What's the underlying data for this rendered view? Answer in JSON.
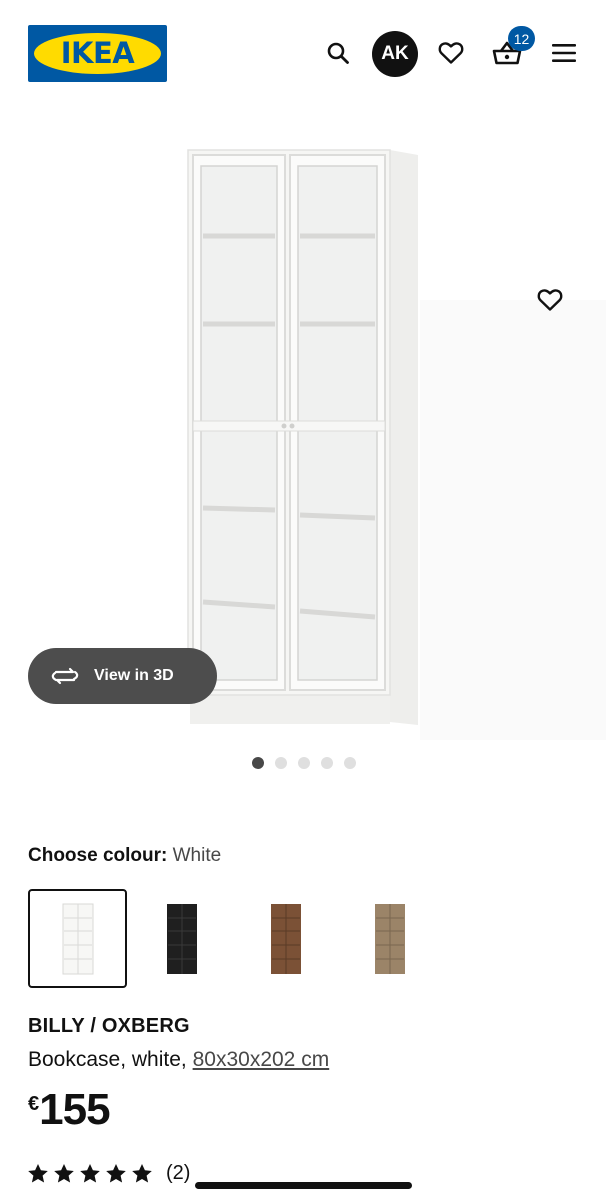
{
  "header": {
    "logo_text": "IKEA",
    "avatar_initials": "AK",
    "cart_count": "12",
    "icons": [
      "search-icon",
      "heart-icon",
      "basket-icon",
      "menu-icon"
    ],
    "brand_blue": "#0058a3",
    "brand_yellow": "#ffdb00"
  },
  "gallery": {
    "view_3d_label": "View in 3D",
    "image_count": 5,
    "active_index": 0
  },
  "colour": {
    "label": "Choose colour:",
    "selected_value": "White",
    "options": [
      {
        "name": "white",
        "color": "#f4f4f2",
        "selected": true
      },
      {
        "name": "black",
        "color": "#1f1f1f",
        "selected": false
      },
      {
        "name": "brown",
        "color": "#7b5136",
        "selected": false
      },
      {
        "name": "oak",
        "color": "#9b8468",
        "selected": false
      }
    ]
  },
  "product": {
    "name": "BILLY / OXBERG",
    "description": "Bookcase, white,",
    "dimensions": "80x30x202 cm",
    "currency": "€",
    "price": "155",
    "rating_stars": 5,
    "review_count": "(2)"
  }
}
